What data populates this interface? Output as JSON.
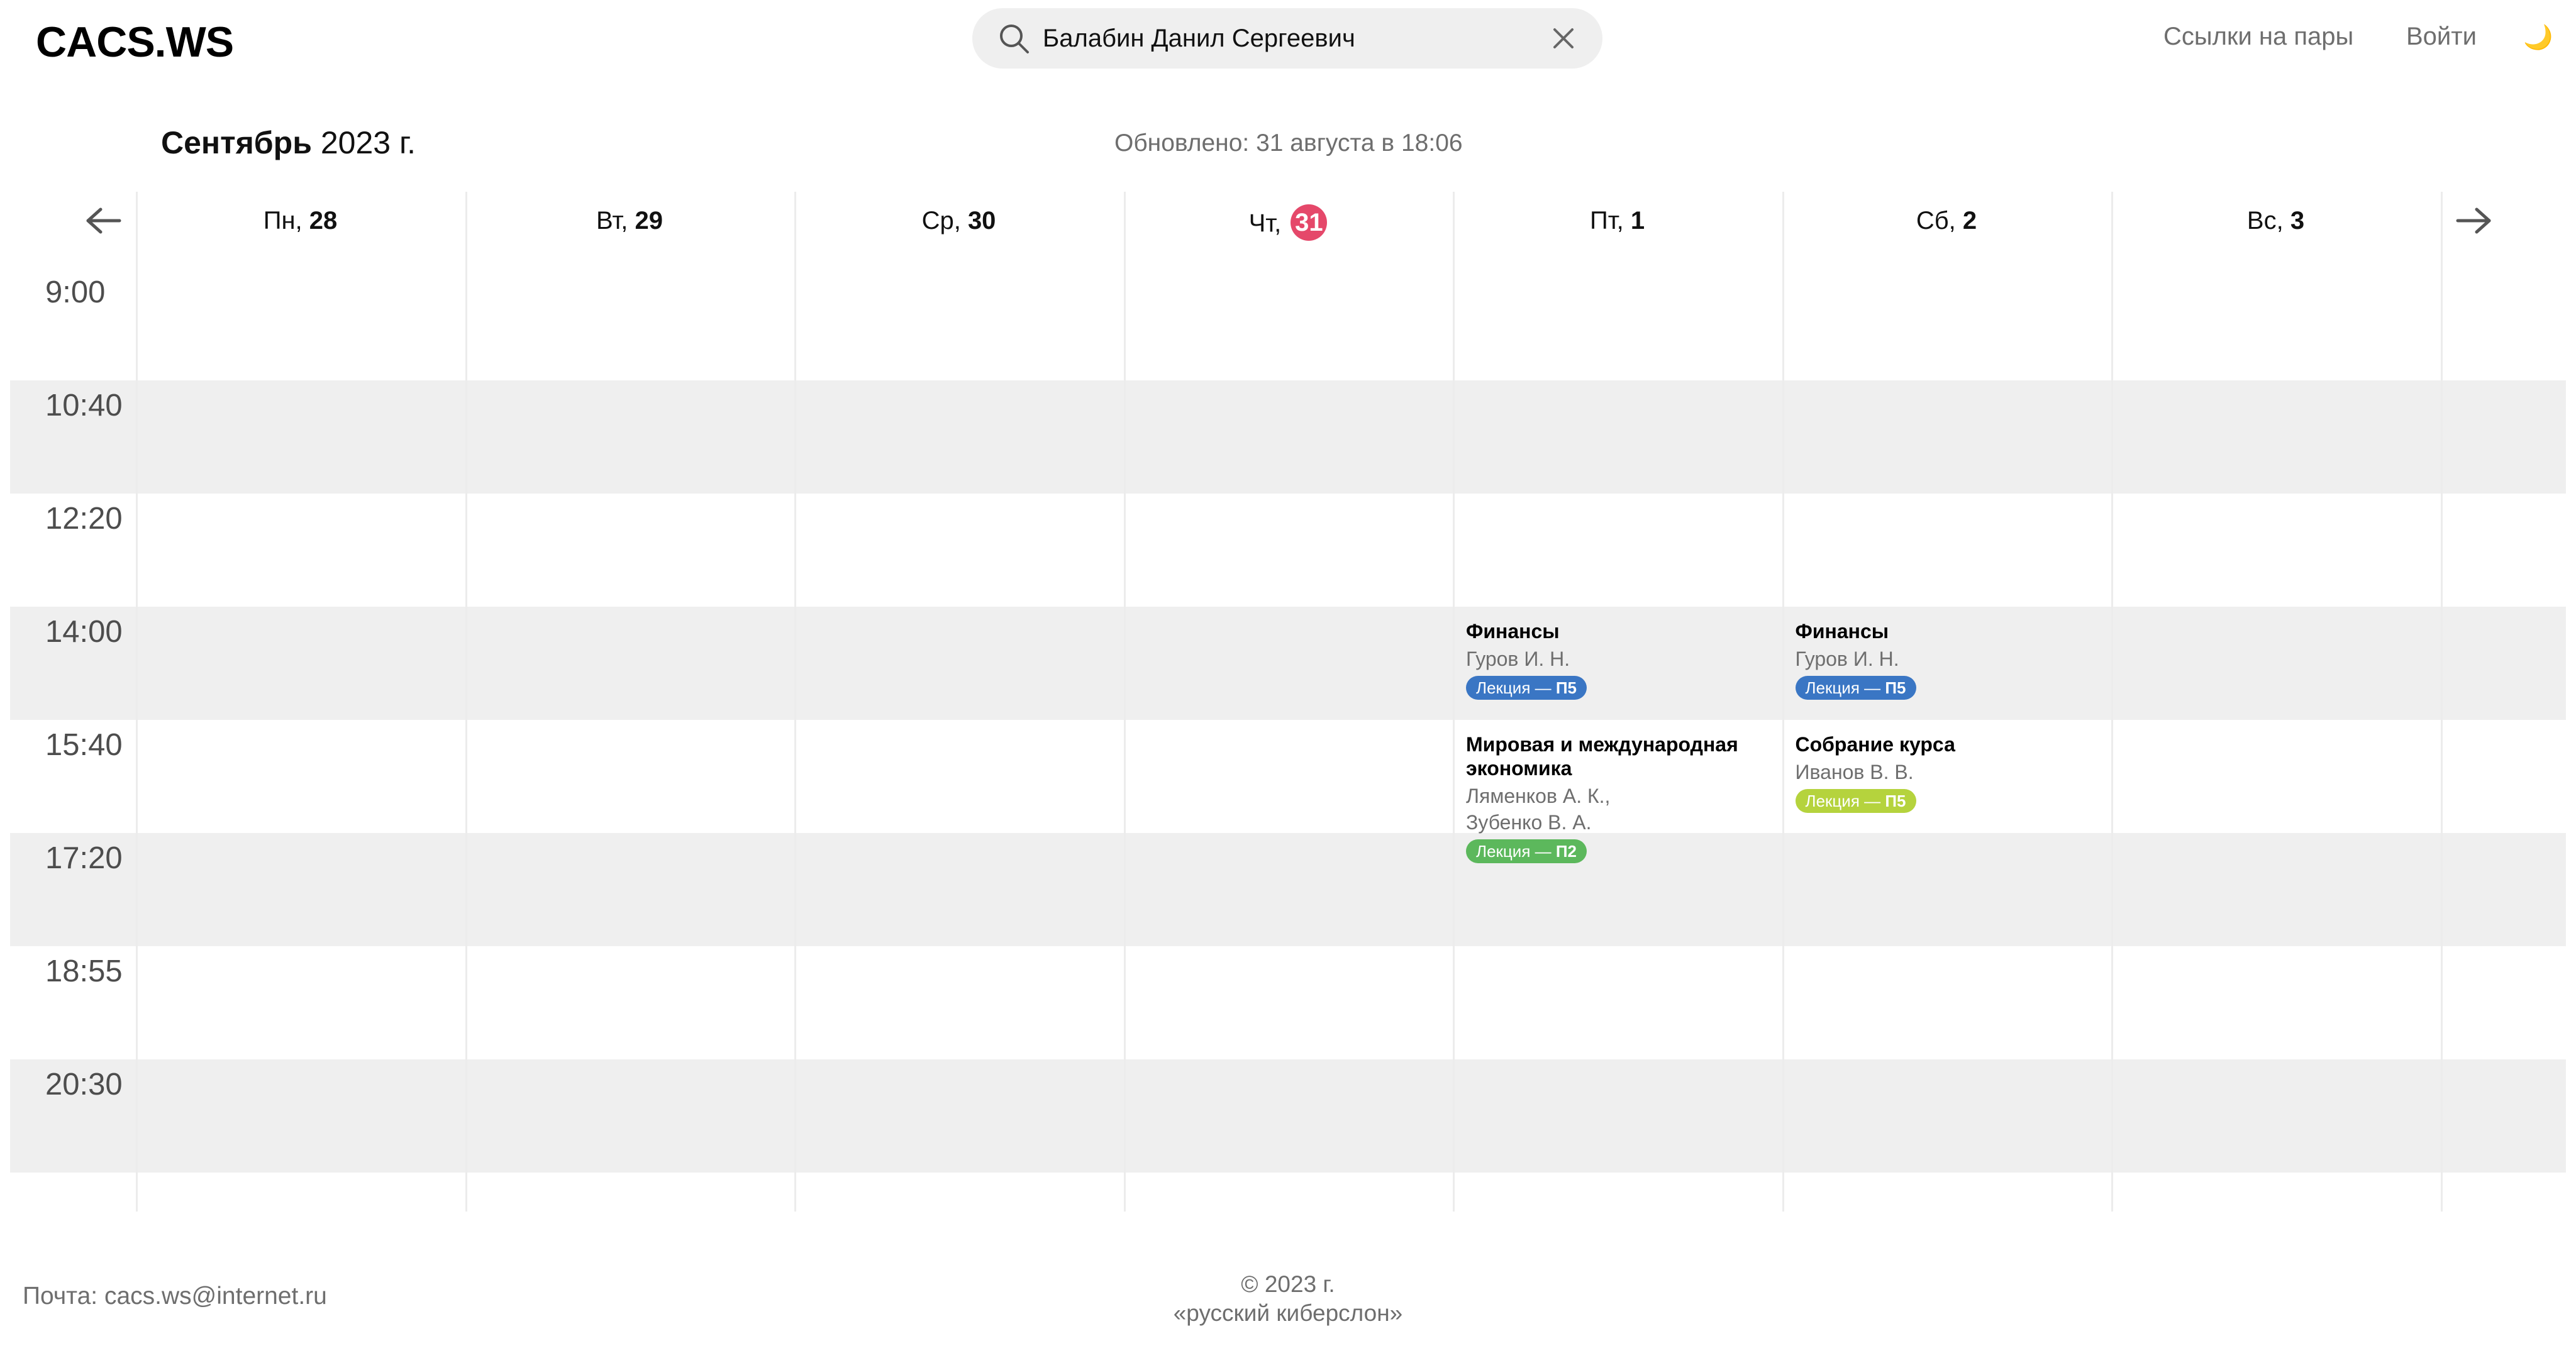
{
  "header": {
    "logo": "CACS.WS",
    "search": {
      "value": "Балабин Данил Сергеевич",
      "icon": "search-icon",
      "clear_icon": "close-icon"
    },
    "links_label": "Ссылки на пары",
    "login_label": "Войти",
    "theme_icon": "🌙"
  },
  "calendar": {
    "month_name": "Сентябрь",
    "year": "2023 г.",
    "updated": "Обновлено: 31 августа в 18:06",
    "prev_icon": "arrow-left-icon",
    "next_icon": "arrow-right-icon",
    "days": [
      {
        "weekday": "Пн,",
        "date": "28",
        "today": false
      },
      {
        "weekday": "Вт,",
        "date": "29",
        "today": false
      },
      {
        "weekday": "Ср,",
        "date": "30",
        "today": false
      },
      {
        "weekday": "Чт,",
        "date": "31",
        "today": true
      },
      {
        "weekday": "Пт,",
        "date": "1",
        "today": false
      },
      {
        "weekday": "Сб,",
        "date": "2",
        "today": false
      },
      {
        "weekday": "Вс,",
        "date": "3",
        "today": false
      }
    ],
    "time_slots": [
      "9:00",
      "10:40",
      "12:20",
      "14:00",
      "15:40",
      "17:20",
      "18:55",
      "20:30"
    ],
    "events": [
      {
        "day": 4,
        "slot": 3,
        "title": "Финансы",
        "teachers": [
          "Гуров И. Н."
        ],
        "type": "Лекция —",
        "room": "П5",
        "color": "#3a76c4"
      },
      {
        "day": 5,
        "slot": 3,
        "title": "Финансы",
        "teachers": [
          "Гуров И. Н."
        ],
        "type": "Лекция —",
        "room": "П5",
        "color": "#3a76c4"
      },
      {
        "day": 4,
        "slot": 4,
        "title": "Мировая и международная экономика",
        "teachers": [
          "Ляменков А. К.,",
          "Зубенко В. А."
        ],
        "type": "Лекция —",
        "room": "П2",
        "color": "#5cb85c"
      },
      {
        "day": 5,
        "slot": 4,
        "title": "Собрание курса",
        "teachers": [
          "Иванов В. В."
        ],
        "type": "Лекция —",
        "room": "П5",
        "color": "#b5d33d"
      }
    ]
  },
  "footer": {
    "mail": "Почта: cacs.ws@internet.ru",
    "copyright": "© 2023 г.",
    "org": "«русский киберслон»"
  }
}
